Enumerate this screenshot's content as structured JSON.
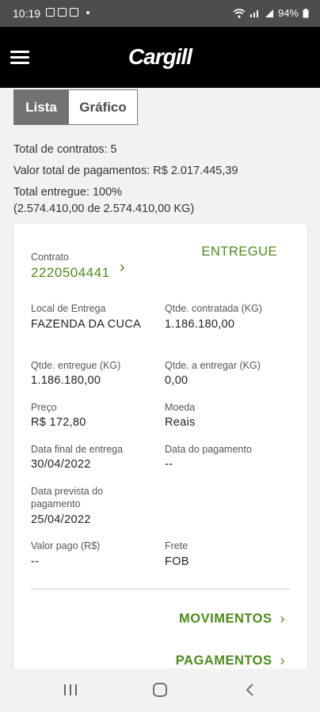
{
  "status_bar": {
    "time": "10:19",
    "battery": "94%"
  },
  "app": {
    "logo_text": "Cargill"
  },
  "tabs": [
    {
      "label": "Lista",
      "active": true
    },
    {
      "label": "Gráfico",
      "active": false
    }
  ],
  "summary": {
    "total_contratos": "Total de contratos: 5",
    "valor_total": "Valor total de pagamentos: R$ 2.017.445,39",
    "total_entregue": "Total entregue: 100%",
    "entregue_detalhe": "(2.574.410,00 de 2.574.410,00 KG)"
  },
  "contract": {
    "contrato_label": "Contrato",
    "contrato_numero": "2220504441",
    "status": "ENTREGUE",
    "local_entrega_label": "Local de Entrega",
    "local_entrega": "FAZENDA DA CUCA",
    "qtde_contratada_label": "Qtde. contratada (KG)",
    "qtde_contratada": "1.186.180,00",
    "qtde_entregue_label": "Qtde. entregue (KG)",
    "qtde_entregue": "1.186.180,00",
    "qtde_a_entregar_label": "Qtde. a entregar (KG)",
    "qtde_a_entregar": "0,00",
    "preco_label": "Preço",
    "preco": "R$ 172,80",
    "moeda_label": "Moeda",
    "moeda": "Reais",
    "data_final_label": "Data final de entrega",
    "data_final": "30/04/2022",
    "data_pagamento_label": "Data do pagamento",
    "data_pagamento": "--",
    "data_prevista_label_1": "Data prevista do",
    "data_prevista_label_2": "pagamento",
    "data_prevista": "25/04/2022",
    "valor_pago_label": "Valor pago (R$)",
    "valor_pago": "--",
    "frete_label": "Frete",
    "frete": "FOB",
    "movimentos": "MOVIMENTOS",
    "pagamentos": "PAGAMENTOS"
  },
  "colors": {
    "accent_green": "#4e8a1c",
    "app_bar": "#000000",
    "status_bar": "#4d4d4d"
  }
}
